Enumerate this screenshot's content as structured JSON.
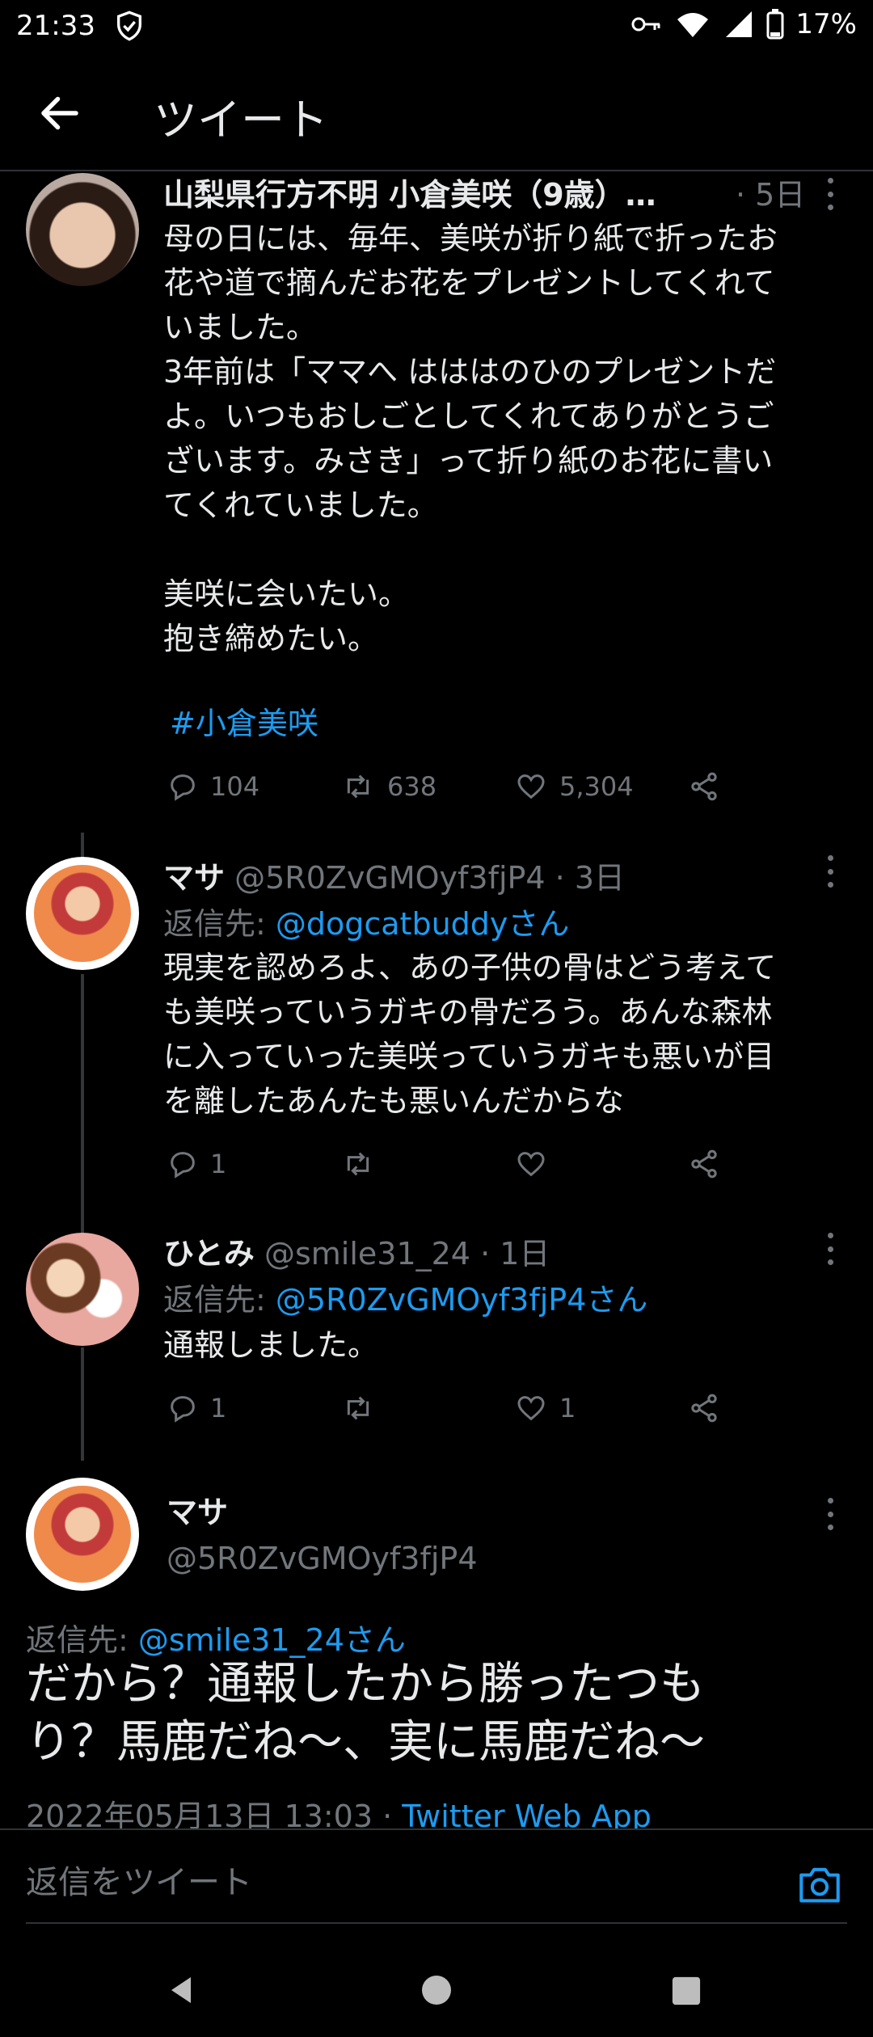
{
  "status_bar": {
    "time": "21:33",
    "battery": "17%"
  },
  "header": {
    "title": "ツイート"
  },
  "tweet1": {
    "name": "山梨県行方不明 小倉美咲（9歳）…",
    "time": "· 5日",
    "text": "母の日には、毎年、美咲が折り紙で折ったお\n花や道で摘んだお花をプレゼントしてくれて\nいました。\n3年前は「ママへ はははのひのプレゼントだ\nよ。いつもおしごとしてくれてありがとうご\nざいます。みさき」って折り紙のお花に書い\nてくれていました。\n\n美咲に会いたい。\n抱き締めたい。",
    "hashtag": "#小倉美咲",
    "replies": "104",
    "retweets": "638",
    "likes": "5,304"
  },
  "tweet2": {
    "name": "マサ",
    "handle": "@5R0ZvGMOyf3fjP4 · 3日",
    "reply_prefix": "返信先: ",
    "reply_to": "@dogcatbuddyさん",
    "text": "現実を認めろよ、あの子供の骨はどう考えて\nも美咲っていうガキの骨だろう。あんな森林\nに入っていった美咲っていうガキも悪いが目\nを離したあんたも悪いんだからな",
    "replies": "1"
  },
  "tweet3": {
    "name": "ひとみ",
    "handle": "@smile31_24 · 1日",
    "reply_prefix": "返信先: ",
    "reply_to": "@5R0ZvGMOyf3fjP4さん",
    "text": "通報しました。",
    "replies": "1",
    "likes": "1"
  },
  "main_tweet": {
    "name": "マサ",
    "handle": "@5R0ZvGMOyf3fjP4",
    "reply_prefix": "返信先: ",
    "reply_to": "@smile31_24さん",
    "text": "だから？通報したから勝ったつも\nり？馬鹿だね〜、実に馬鹿だね〜",
    "date": "2022年05月13日 13:03 · ",
    "source": "Twitter Web App"
  },
  "reply_bar": {
    "placeholder": "返信をツイート"
  },
  "colors": {
    "accent": "#1d9bf0",
    "muted": "#71767b",
    "text": "#e7e9ea",
    "background": "#000000"
  }
}
